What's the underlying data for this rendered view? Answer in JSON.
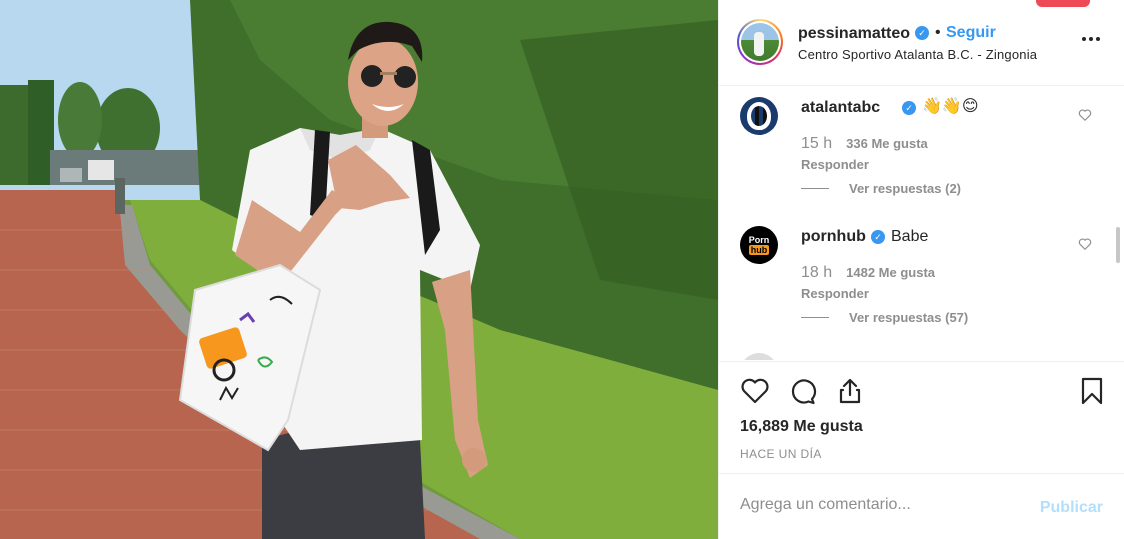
{
  "post": {
    "username": "pessinamatteo",
    "follow_label": "Seguir",
    "separator": "•",
    "location": "Centro Sportivo Atalanta B.C. - Zingonia"
  },
  "comments": [
    {
      "username": "atalantabc",
      "verified": true,
      "text": "",
      "emoji": [
        "👋",
        "👋",
        "😊"
      ],
      "time": "15 h",
      "likes": "336 Me gusta",
      "reply_label": "Responder",
      "view_replies": "Ver respuestas (2)"
    },
    {
      "username": "pornhub",
      "verified": true,
      "text": "Babe",
      "avatar_text_top": "Porn",
      "avatar_text_bottom": "hub",
      "time": "18 h",
      "likes": "1482 Me gusta",
      "reply_label": "Responder",
      "view_replies": "Ver respuestas (57)"
    }
  ],
  "actions": {
    "like_icon": "heart-icon",
    "comment_icon": "speech-bubble-icon",
    "share_icon": "share-icon",
    "save_icon": "bookmark-icon"
  },
  "likes_count": "16,889 Me gusta",
  "date": "HACE UN DÍA",
  "comment_box": {
    "placeholder": "Agrega un comentario...",
    "publish_label": "Publicar"
  },
  "colors": {
    "accent": "#3897f0",
    "publish_disabled": "#b2dffc",
    "muted": "#8e8e8e",
    "text": "#262626"
  }
}
